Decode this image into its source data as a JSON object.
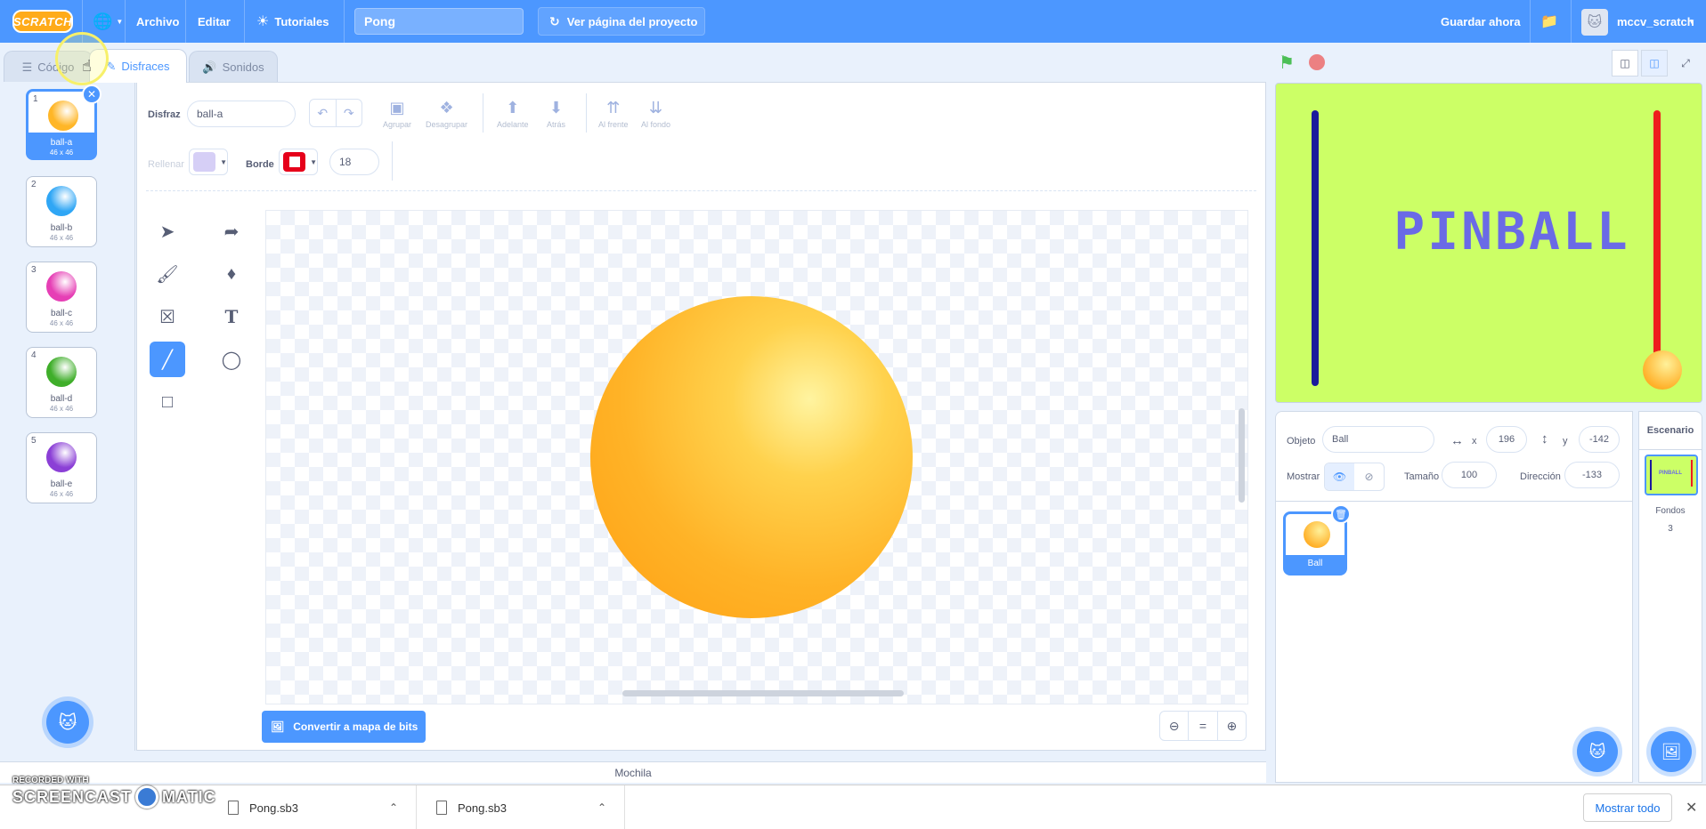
{
  "menubar": {
    "logo": "SCRATCH",
    "file": "Archivo",
    "edit": "Editar",
    "tutorials": "Tutoriales",
    "project_title": "Pong",
    "see_project": "Ver página del proyecto",
    "save_now": "Guardar ahora",
    "username": "mccv_scratch"
  },
  "tabs": {
    "code": "Código",
    "costumes": "Disfraces",
    "sounds": "Sonidos"
  },
  "costumes": [
    {
      "num": "1",
      "name": "ball-a",
      "size": "46 x 46",
      "color": "#ffb627"
    },
    {
      "num": "2",
      "name": "ball-b",
      "size": "46 x 46",
      "color": "#2fa6f5"
    },
    {
      "num": "3",
      "name": "ball-c",
      "size": "46 x 46",
      "color": "#e63fb5"
    },
    {
      "num": "4",
      "name": "ball-d",
      "size": "46 x 46",
      "color": "#3fae2a"
    },
    {
      "num": "5",
      "name": "ball-e",
      "size": "46 x 46",
      "color": "#8b3fd6"
    }
  ],
  "editor": {
    "costume_label": "Disfraz",
    "costume_name": "ball-a",
    "group": "Agrupar",
    "ungroup": "Desagrupar",
    "forward": "Adelante",
    "backward": "Atrás",
    "front": "Al frente",
    "back": "Al fondo",
    "fill_label": "Rellenar",
    "outline_label": "Borde",
    "outline_width": "18",
    "fill_color": "#d6cff6",
    "outline_color": "#e6001a",
    "convert_bitmap": "Convertir a mapa de bits",
    "zoom_equal": "="
  },
  "backpack": "Mochila",
  "stage": {
    "title_text": "PINBALL"
  },
  "sprite_info": {
    "object_label": "Objeto",
    "object_name": "Ball",
    "x_label": "x",
    "x_value": "196",
    "y_label": "y",
    "y_value": "-142",
    "show_label": "Mostrar",
    "size_label": "Tamaño",
    "size_value": "100",
    "direction_label": "Dirección",
    "direction_value": "-133",
    "sprite_name": "Ball"
  },
  "stage_pane": {
    "header": "Escenario",
    "thumb_text": "PINBALL",
    "backdrops_label": "Fondos",
    "backdrops_count": "3"
  },
  "downloads": {
    "items": [
      "Pong.sb3",
      "Pong.sb3"
    ],
    "show_all": "Mostrar todo"
  },
  "watermark": {
    "top": "RECORDED WITH",
    "left": "SCREENCAST",
    "right": "MATIC"
  }
}
